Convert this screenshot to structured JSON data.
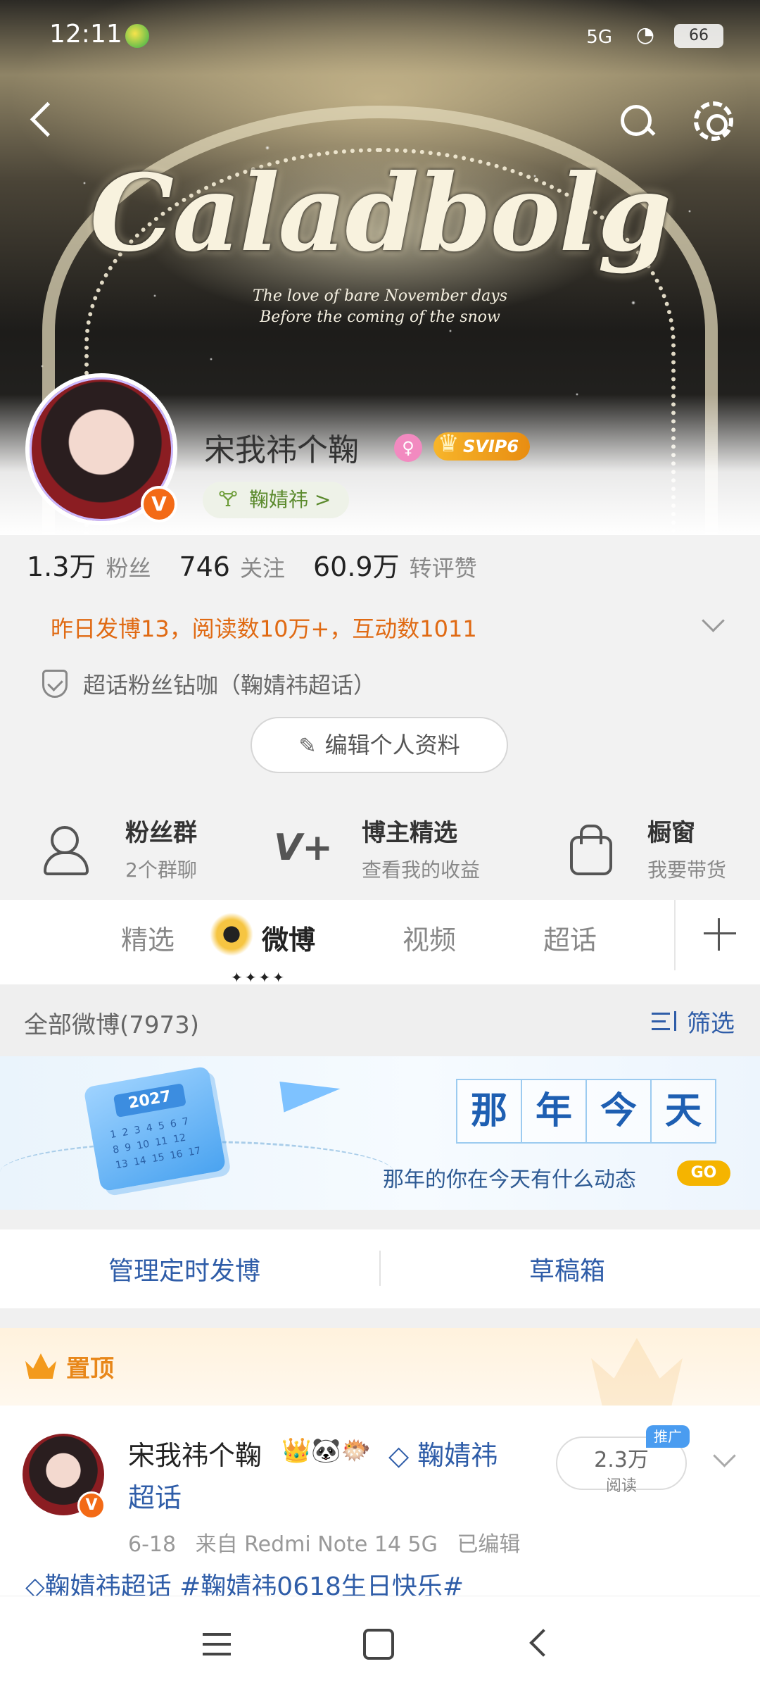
{
  "status_bar": {
    "time": "12:11",
    "signal": "5G",
    "battery": "66"
  },
  "banner": {
    "title": "Caladbolg",
    "subtitle_line1": "The love of bare November days",
    "subtitle_line2": "Before the coming of the snow"
  },
  "profile": {
    "username": "宋我祎个鞠",
    "vip_badge": "SVIP6",
    "fan_tag": "鞠婧祎 >",
    "stats": [
      {
        "value": "1.3万",
        "label": "粉丝"
      },
      {
        "value": "746",
        "label": "关注"
      },
      {
        "value": "60.9万",
        "label": "转评赞"
      }
    ],
    "activity": "昨日发博13，阅读数10万+，互动数1011",
    "chaohua": "超话粉丝钻咖（鞠婧祎超话）",
    "edit_button": "编辑个人资料"
  },
  "features": [
    {
      "title": "粉丝群",
      "subtitle": "2个群聊",
      "icon": "group-icon"
    },
    {
      "title": "博主精选",
      "subtitle": "查看我的收益",
      "icon": "v-plus-icon"
    },
    {
      "title": "橱窗",
      "subtitle": "我要带货",
      "icon": "shopping-bag-icon"
    }
  ],
  "tabs": [
    "精选",
    "微博",
    "视频",
    "超话"
  ],
  "section": {
    "all_posts": "全部微博(7973)",
    "filter": "筛选"
  },
  "memory_banner": {
    "calendar_year": "2027",
    "headline_chars": [
      "那",
      "年",
      "今",
      "天"
    ],
    "subtitle": "那年的你在今天有什么动态",
    "go": "GO"
  },
  "actions": {
    "scheduled": "管理定时发博",
    "drafts": "草稿箱"
  },
  "pinned": {
    "label": "置顶"
  },
  "post": {
    "author": "宋我祎个鞠",
    "emojis": "👑🐼🐡",
    "chaohua_prefix": "◇ 鞠婧祎",
    "chaohua_suffix": "超话",
    "reads": "2.3万",
    "reads_label": "阅读",
    "promo": "推广",
    "date": "6-18",
    "source": "来自 Redmi Note 14 5G",
    "edited": "已编辑",
    "body": "◇鞠婧祎超话 #鞠婧祎0618生日快乐#"
  },
  "colors": {
    "accent_orange": "#e06a13",
    "link_blue": "#2f5da8",
    "vip_gold": "#f7b52a"
  }
}
